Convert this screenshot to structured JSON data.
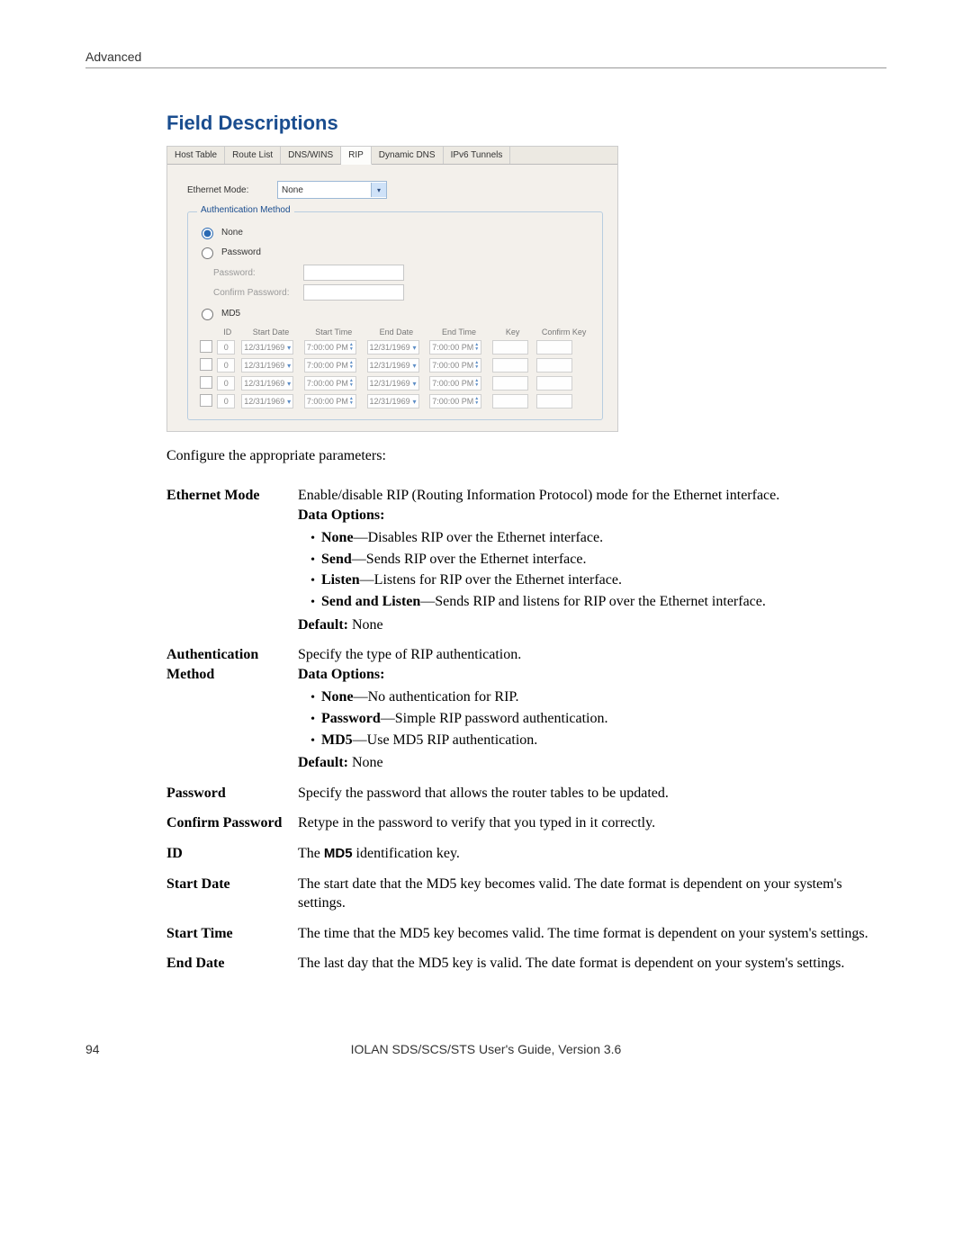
{
  "header": {
    "section": "Advanced"
  },
  "title": "Field Descriptions",
  "dialog": {
    "tabs": [
      "Host Table",
      "Route List",
      "DNS/WINS",
      "RIP",
      "Dynamic DNS",
      "IPv6 Tunnels"
    ],
    "active_tab": "RIP",
    "ethernet_mode_label": "Ethernet Mode:",
    "ethernet_mode_value": "None",
    "auth": {
      "legend": "Authentication Method",
      "none": "None",
      "password": "Password",
      "password_label": "Password:",
      "confirm_label": "Confirm Password:",
      "md5": "MD5",
      "columns": [
        "ID",
        "Start Date",
        "Start Time",
        "End Date",
        "End Time",
        "Key",
        "Confirm Key"
      ],
      "rows": [
        {
          "id": "0",
          "sd": "12/31/1969",
          "st": "7:00:00 PM",
          "ed": "12/31/1969",
          "et": "7:00:00 PM"
        },
        {
          "id": "0",
          "sd": "12/31/1969",
          "st": "7:00:00 PM",
          "ed": "12/31/1969",
          "et": "7:00:00 PM"
        },
        {
          "id": "0",
          "sd": "12/31/1969",
          "st": "7:00:00 PM",
          "ed": "12/31/1969",
          "et": "7:00:00 PM"
        },
        {
          "id": "0",
          "sd": "12/31/1969",
          "st": "7:00:00 PM",
          "ed": "12/31/1969",
          "et": "7:00:00 PM"
        }
      ]
    }
  },
  "intro": "Configure the appropriate parameters:",
  "fields": {
    "ethernet_mode": {
      "term": "Ethernet Mode",
      "desc": "Enable/disable RIP (Routing Information Protocol) mode for the Ethernet interface.",
      "data_options_label": "Data Options:",
      "options": {
        "none": {
          "name": "None",
          "text": "—Disables RIP over the Ethernet interface."
        },
        "send": {
          "name": "Send",
          "text": "—Sends RIP over the Ethernet interface."
        },
        "listen": {
          "name": "Listen",
          "text": "—Listens for RIP over the Ethernet interface."
        },
        "send_listen": {
          "name": "Send and Listen",
          "text": "—Sends RIP and listens for RIP over the Ethernet interface."
        }
      },
      "default_label": "Default:",
      "default_value": " None"
    },
    "auth_method": {
      "term1": "Authentication",
      "term2": "Method",
      "desc": "Specify the type of RIP authentication.",
      "data_options_label": "Data Options:",
      "options": {
        "none": {
          "name": "None",
          "text": "—No authentication for RIP."
        },
        "password": {
          "name": "Password",
          "text": "—Simple RIP password authentication."
        },
        "md5": {
          "name": "MD5",
          "text": "—Use MD5 RIP authentication."
        }
      },
      "default_label": "Default:",
      "default_value": " None"
    },
    "password": {
      "term": "Password",
      "desc": "Specify the password that allows the router tables to be updated."
    },
    "confirm_password": {
      "term": "Confirm Password",
      "desc": "Retype in the password to verify that you typed in it correctly."
    },
    "id": {
      "term": "ID",
      "desc_pre": "The ",
      "desc_bold": "MD5",
      "desc_post": " identification key."
    },
    "start_date": {
      "term": "Start Date",
      "desc": "The start date that the MD5 key becomes valid. The date format is dependent on your system's settings."
    },
    "start_time": {
      "term": "Start Time",
      "desc": "The time that the MD5 key becomes valid. The time format is dependent on your system's settings."
    },
    "end_date": {
      "term": "End Date",
      "desc": "The last day that the MD5 key is valid. The date format is dependent on your system's settings."
    }
  },
  "footer": {
    "page": "94",
    "text": "IOLAN SDS/SCS/STS User's Guide, Version 3.6"
  }
}
